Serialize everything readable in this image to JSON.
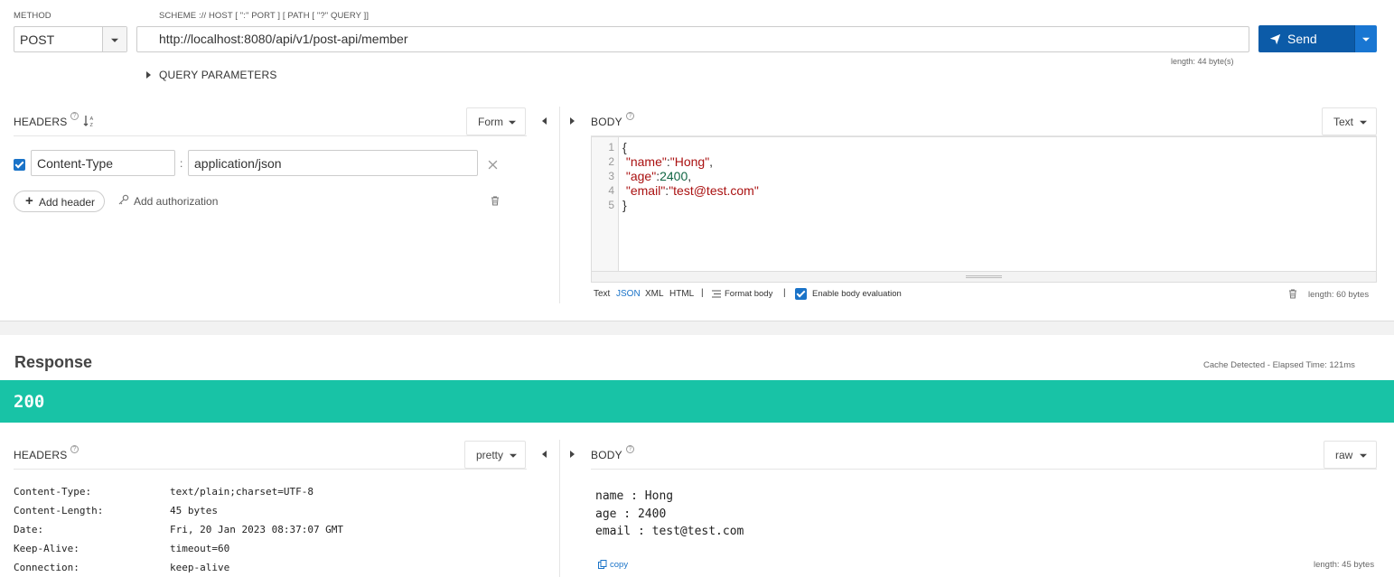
{
  "request": {
    "method_label": "METHOD",
    "method_value": "POST",
    "url_label": "SCHEME :// HOST [ \":\" PORT ] [ PATH [ \"?\" QUERY ]]",
    "url_value": "http://localhost:8080/api/v1/post-api/member",
    "url_length": "length: 44 byte(s)",
    "send_label": "Send",
    "query_params_label": "QUERY PARAMETERS"
  },
  "req_headers": {
    "title": "HEADERS",
    "mode": "Form",
    "rows": [
      {
        "name": "Content-Type",
        "value": "application/json",
        "checked": true
      }
    ],
    "add_header": "Add header",
    "add_auth": "Add authorization"
  },
  "req_body": {
    "title": "BODY",
    "mode": "Text",
    "line_numbers": [
      "1",
      "2",
      "3",
      "4",
      "5"
    ],
    "lines": {
      "l1": "{",
      "l2_key": "\"name\"",
      "l2_colon": ":",
      "l2_val": "\"Hong\"",
      "l2_end": ",",
      "l3_key": "\"age\"",
      "l3_colon": ":",
      "l3_val": "2400",
      "l3_end": ",",
      "l4_key": "\"email\"",
      "l4_colon": ":",
      "l4_val": "\"test@test.com\"",
      "l5": "}"
    },
    "formats": [
      "Text",
      "JSON",
      "XML",
      "HTML"
    ],
    "active_format": "JSON",
    "separator": "|",
    "format_body": "Format body",
    "enable_eval": "Enable body evaluation",
    "length": "length: 60 bytes"
  },
  "response": {
    "title": "Response",
    "elapsed": "Cache Detected - Elapsed Time: 121ms",
    "status": "200",
    "status_color": "#18c3a6",
    "headers_title": "HEADERS",
    "headers_mode": "pretty",
    "headers": [
      {
        "name": "Content-Type:",
        "value": "text/plain;charset=UTF-8"
      },
      {
        "name": "Content-Length:",
        "value": "45 bytes"
      },
      {
        "name": "Date:",
        "value": "Fri, 20 Jan 2023 08:37:07 GMT"
      },
      {
        "name": "Keep-Alive:",
        "value": "timeout=60"
      },
      {
        "name": "Connection:",
        "value": "keep-alive"
      }
    ],
    "body_title": "BODY",
    "body_mode": "raw",
    "body_lines": [
      "name : Hong",
      "age : 2400",
      "email : test@test.com"
    ],
    "copy_label": "copy",
    "length": "length: 45 bytes"
  },
  "colors": {
    "accent": "#0c5ba8",
    "link": "#1a73c8"
  }
}
